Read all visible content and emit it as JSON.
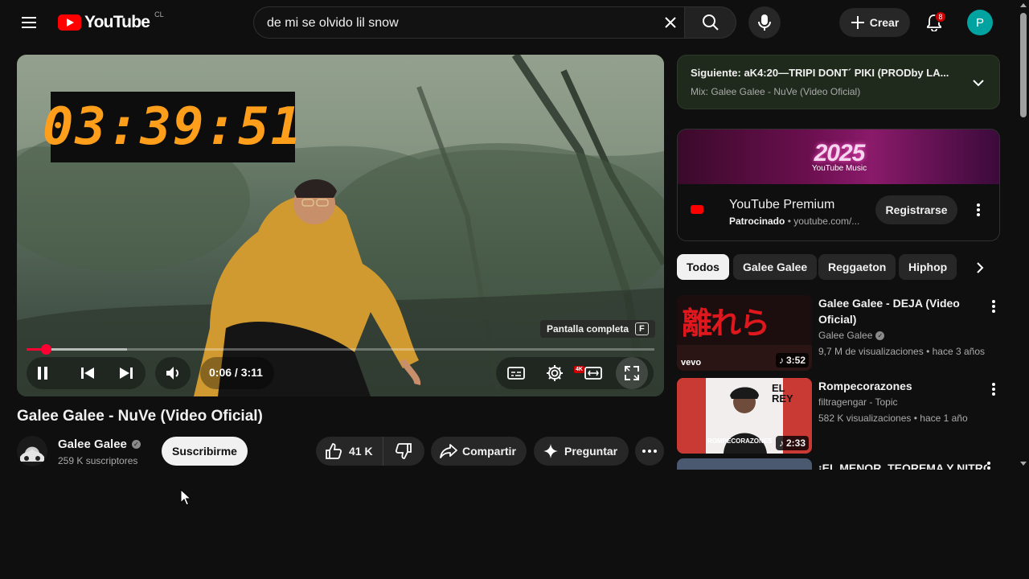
{
  "header": {
    "logo_text": "YouTube",
    "region": "CL",
    "search_value": "de mi se olvido lil snow",
    "create_label": "Crear",
    "notification_count": "8",
    "avatar_letter": "P"
  },
  "player": {
    "clock_overlay": "03:39:51",
    "tooltip_label": "Pantalla completa",
    "tooltip_key": "F",
    "current_time": "0:06",
    "duration": "3:11",
    "time_display": "0:06 / 3:11",
    "played_fraction": 0.031,
    "buffered_fraction": 0.16,
    "quality_badge": "4K"
  },
  "video": {
    "title": "Galee Galee - NuVe (Video Oficial)",
    "channel": "Galee Galee",
    "subscribers": "259 K suscriptores",
    "subscribe_label": "Suscribirme",
    "likes": "41 K",
    "share_label": "Compartir",
    "ask_label": "Preguntar"
  },
  "next_up": {
    "title": "Siguiente: aK4:20—TRIPI DONT´ PIKI (PRODby LA...",
    "subtitle": "Mix: Galee Galee - NuVe (Video Oficial)"
  },
  "ad": {
    "banner_text": "2025",
    "banner_brand": "YouTube Music",
    "title": "YouTube Premium",
    "sponsored": "Patrocinado",
    "domain": "youtube.com/...",
    "cta": "Registrarse"
  },
  "chips": [
    "Todos",
    "Galee Galee",
    "Reggaeton",
    "Hiphop"
  ],
  "recommendations": [
    {
      "title": "Galee Galee - DEJA (Video Oficial)",
      "channel": "Galee Galee",
      "stats": "9,7 M de visualizaciones • hace 3 años",
      "duration": "3:52",
      "thumb_text": "離れら",
      "thumb_label": "vevo"
    },
    {
      "title": "Rompecorazones",
      "channel": "filtragengar - Topic",
      "stats": "582 K visualizaciones • hace 1 año",
      "duration": "2:33",
      "thumb_text": "EL REY",
      "thumb_label": "ROMPECORAZONES"
    },
    {
      "title": "¡EL MENOR, TEOREMA Y NITRO"
    }
  ],
  "colors": {
    "accent": "#ff0033",
    "clock": "#ff9e1b",
    "background": "#0f0f0f"
  },
  "icons": {
    "menu": "hamburger-icon",
    "search": "search-icon",
    "mic": "mic-icon",
    "bell": "bell-icon"
  }
}
